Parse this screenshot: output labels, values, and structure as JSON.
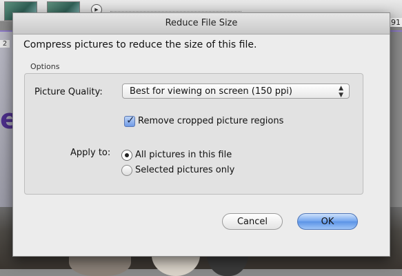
{
  "background": {
    "corner_number": "91",
    "left_number": "2",
    "partial_letters": "ep",
    "play_icon": "play-circle-icon"
  },
  "dialog": {
    "title": "Reduce File Size",
    "lead_text": "Compress pictures to reduce the size of this file.",
    "options_label": "Options",
    "picture_quality": {
      "label": "Picture Quality:",
      "selected": "Best for viewing on screen (150 ppi)"
    },
    "remove_cropped": {
      "label": "Remove cropped picture regions",
      "checked": true
    },
    "apply_to": {
      "label": "Apply to:",
      "options": [
        {
          "label": "All pictures in this file",
          "selected": true
        },
        {
          "label": "Selected pictures only",
          "selected": false
        }
      ]
    },
    "buttons": {
      "cancel": "Cancel",
      "ok": "OK"
    }
  },
  "colors": {
    "default_button": "#5b93e6",
    "checkbox_fill": "#6f9ae6",
    "background_accent": "#4d2f8c"
  }
}
